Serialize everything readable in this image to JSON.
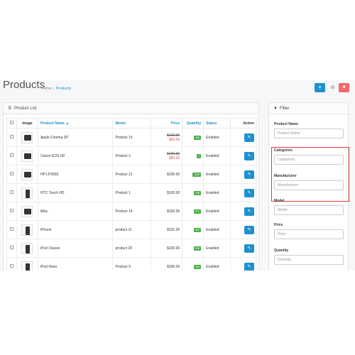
{
  "header": {
    "title": "Products",
    "breadcrumb": [
      "Home",
      "Products"
    ],
    "add_icon": "+",
    "help_icon": "⊘",
    "delete_icon": "■"
  },
  "list": {
    "heading": "Product List",
    "columns": {
      "image": "Image",
      "name": "Product Name",
      "sort_arrow": "▲",
      "model": "Model",
      "price": "Price",
      "quantity": "Quantity",
      "status": "Status",
      "action": "Action"
    },
    "rows": [
      {
        "name": "Apple Cinema 30\"",
        "model": "Product 15",
        "price": "$100.00",
        "special": "$90.00",
        "quantity": "990",
        "status": "Enabled"
      },
      {
        "name": "Canon EOS 5D",
        "model": "Product 3",
        "price": "$100.00",
        "special": "$80.00",
        "quantity": "7",
        "status": "Enabled"
      },
      {
        "name": "HP LP3065",
        "model": "Product 21",
        "price": "$100.00",
        "special": "",
        "quantity": "1000",
        "status": "Enabled"
      },
      {
        "name": "HTC Touch HD",
        "model": "Product 1",
        "price": "$100.00",
        "special": "",
        "quantity": "939",
        "status": "Enabled"
      },
      {
        "name": "iMac",
        "model": "Product 14",
        "price": "$100.00",
        "special": "",
        "quantity": "977",
        "status": "Enabled"
      },
      {
        "name": "iPhone",
        "model": "product 11",
        "price": "$101.00",
        "special": "",
        "quantity": "967",
        "status": "Enabled"
      },
      {
        "name": "iPod Classic",
        "model": "product 20",
        "price": "$100.00",
        "special": "",
        "quantity": "995",
        "status": "Enabled"
      },
      {
        "name": "iPod Nano",
        "model": "Product 9",
        "price": "$100.00",
        "special": "",
        "quantity": "994",
        "status": "Enabled"
      }
    ]
  },
  "filter": {
    "heading": "Filter",
    "product_name_label": "Product Name",
    "product_name_placeholder": "Product Name",
    "categories_label": "Categories",
    "categories_placeholder": "Categories",
    "manufacturer_label": "Manufacturer",
    "manufacturer_placeholder": "Manufacturer",
    "model_label": "Model",
    "model_placeholder": "Model",
    "price_label": "Price",
    "price_placeholder": "Price",
    "quantity_label": "Quantity",
    "quantity_placeholder": "Quantity"
  },
  "colors": {
    "accent": "#1e91cf",
    "highlight": "#e53935",
    "quantity_badge": "#4cae4c",
    "delete": "#f56b6b"
  }
}
